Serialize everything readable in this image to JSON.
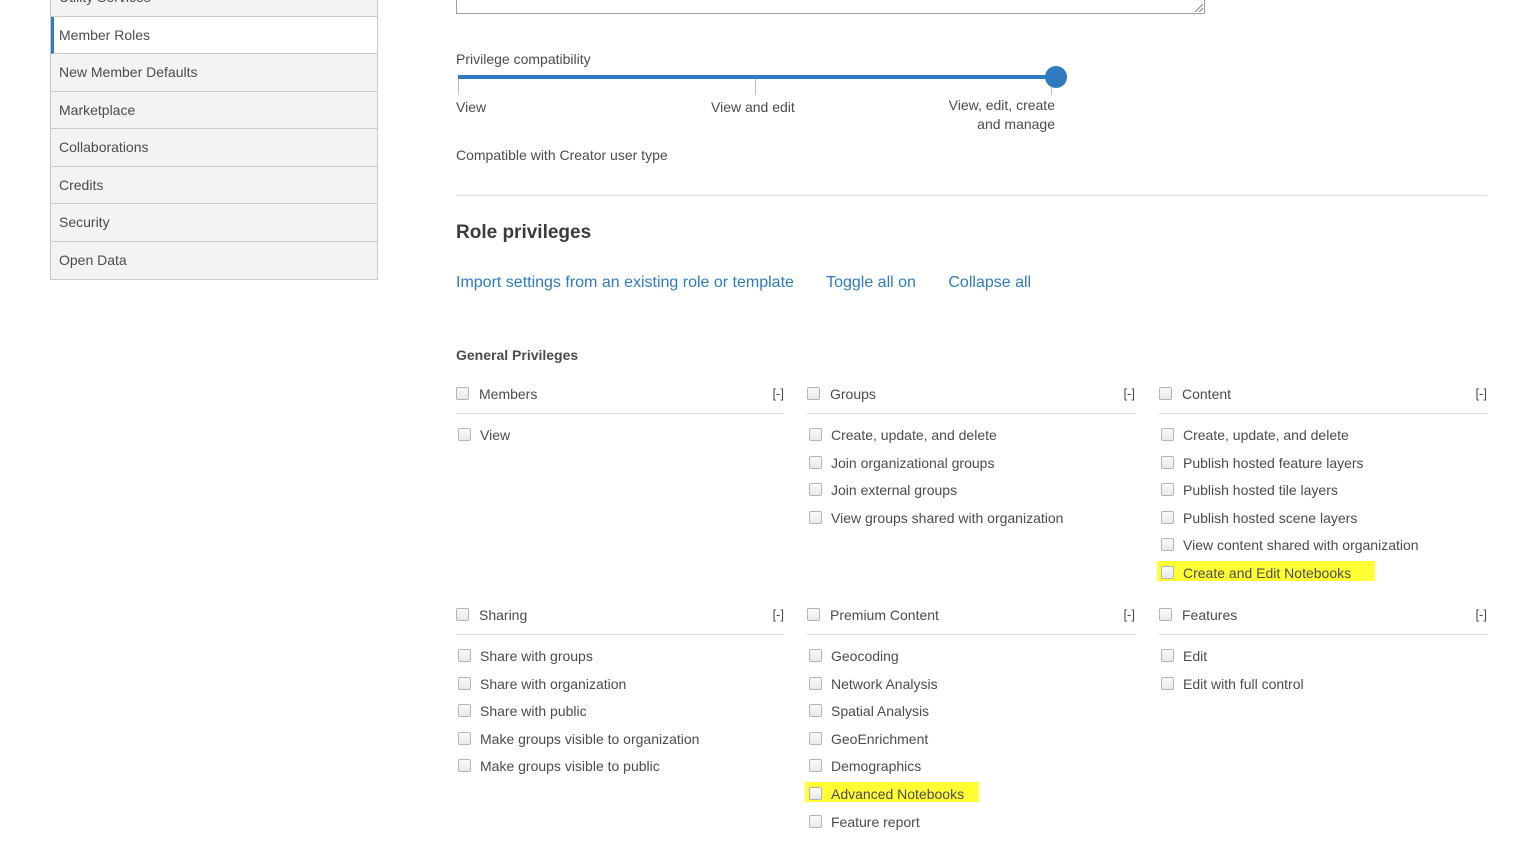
{
  "sidebar": {
    "items": [
      {
        "label": "Utility Services",
        "active": false
      },
      {
        "label": "Member Roles",
        "active": true
      },
      {
        "label": "New Member Defaults",
        "active": false
      },
      {
        "label": "Marketplace",
        "active": false
      },
      {
        "label": "Collaborations",
        "active": false
      },
      {
        "label": "Credits",
        "active": false
      },
      {
        "label": "Security",
        "active": false
      },
      {
        "label": "Open Data",
        "active": false
      }
    ]
  },
  "slider": {
    "label": "Privilege compatibility",
    "stops": [
      "View",
      "View and edit",
      "View, edit, create and manage"
    ],
    "selected_index": 2,
    "compat_text": "Compatible with Creator user type"
  },
  "role_privileges": {
    "title": "Role privileges",
    "links": [
      "Import settings from an existing role or template",
      "Toggle all on",
      "Collapse all"
    ],
    "general_title": "General Privileges",
    "collapse_label": "[-]",
    "blocks": [
      {
        "name": "Members",
        "items": [
          "View"
        ]
      },
      {
        "name": "Groups",
        "items": [
          "Create, update, and delete",
          "Join organizational groups",
          "Join external groups",
          "View groups shared with organization"
        ]
      },
      {
        "name": "Content",
        "items": [
          "Create, update, and delete",
          "Publish hosted feature layers",
          "Publish hosted tile layers",
          "Publish hosted scene layers",
          "View content shared with organization",
          "Create and Edit Notebooks"
        ]
      },
      {
        "name": "Sharing",
        "items": [
          "Share with groups",
          "Share with organization",
          "Share with public",
          "Make groups visible to organization",
          "Make groups visible to public"
        ]
      },
      {
        "name": "Premium Content",
        "items": [
          "Geocoding",
          "Network Analysis",
          "Spatial Analysis",
          "GeoEnrichment",
          "Demographics",
          "Advanced Notebooks",
          "Feature report"
        ]
      },
      {
        "name": "Features",
        "items": [
          "Edit",
          "Edit with full control"
        ]
      }
    ]
  },
  "colors": {
    "accent": "#2e7bbf",
    "highlight": "#ffff33"
  }
}
